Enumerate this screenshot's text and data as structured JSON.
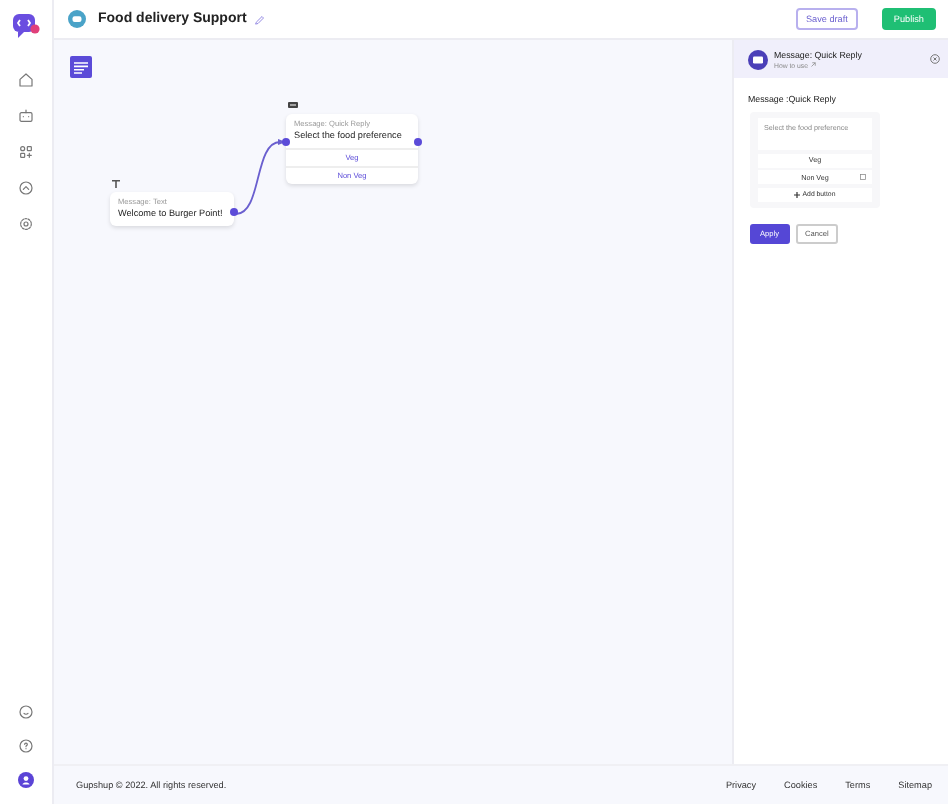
{
  "header": {
    "title": "Food delivery Support",
    "save_draft": "Save draft",
    "publish": "Publish"
  },
  "canvas": {
    "nodes": [
      {
        "kind": "text",
        "type_label": "Message: Text",
        "text": "Welcome to Burger Point!"
      },
      {
        "kind": "quick_reply",
        "type_label": "Message: Quick Reply",
        "text": "Select the food preference",
        "buttons": [
          "Veg",
          "Non Veg"
        ]
      }
    ]
  },
  "panel": {
    "title": "Message: Quick Reply",
    "link": "How to use",
    "section_label": "Message :Quick Reply",
    "body": "Select the food preference",
    "buttons": [
      "Veg",
      "Non Veg"
    ],
    "add_button": "Add button",
    "apply": "Apply",
    "cancel": "Cancel"
  },
  "footer": {
    "copyright": "Gupshup © 2022. All rights reserved.",
    "links": [
      "Privacy",
      "Cookies",
      "Terms",
      "Sitemap"
    ]
  }
}
